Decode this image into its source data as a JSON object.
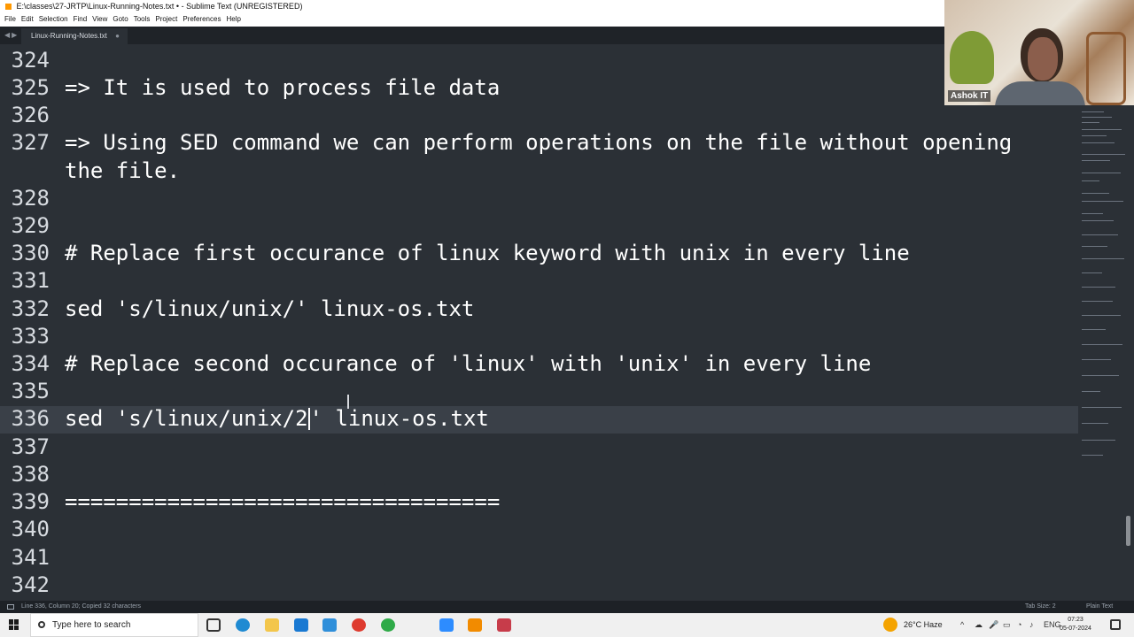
{
  "window": {
    "title": "E:\\classes\\27-JRTP\\Linux-Running-Notes.txt • - Sublime Text (UNREGISTERED)"
  },
  "menu": {
    "items": [
      "File",
      "Edit",
      "Selection",
      "Find",
      "View",
      "Goto",
      "Tools",
      "Project",
      "Preferences",
      "Help"
    ]
  },
  "tab": {
    "nav": "◀▶",
    "name": "Linux-Running-Notes.txt",
    "close": "●"
  },
  "editor": {
    "lines": [
      {
        "number": "324",
        "text": ""
      },
      {
        "number": "325",
        "text": "=> It is used to process file data"
      },
      {
        "number": "326",
        "text": ""
      },
      {
        "number": "327",
        "text": "=> Using SED command we can perform operations on the file without opening"
      },
      {
        "number": "",
        "text": "the file."
      },
      {
        "number": "328",
        "text": ""
      },
      {
        "number": "329",
        "text": ""
      },
      {
        "number": "330",
        "text": "# Replace first occurance of linux keyword with unix in every line"
      },
      {
        "number": "331",
        "text": ""
      },
      {
        "number": "332",
        "text": "sed 's/linux/unix/' linux-os.txt"
      },
      {
        "number": "333",
        "text": ""
      },
      {
        "number": "334",
        "text": "# Replace second occurance of 'linux' with 'unix' in every line"
      },
      {
        "number": "335",
        "text": ""
      },
      {
        "number": "336",
        "text_before_cursor": "sed 's/linux/unix/2",
        "text_after_cursor": "' linux-os.txt"
      },
      {
        "number": "337",
        "text": ""
      },
      {
        "number": "338",
        "text": ""
      },
      {
        "number": "339",
        "text": "=================================="
      },
      {
        "number": "340",
        "text": ""
      },
      {
        "number": "341",
        "text": ""
      },
      {
        "number": "342",
        "text": ""
      }
    ]
  },
  "status": {
    "left": "Line 336, Column 20; Copied 32 characters",
    "tab_size": "Tab Size: 2",
    "syntax": "Plain Text"
  },
  "taskbar": {
    "search_placeholder": "Type here to search",
    "weather": "26°C Haze",
    "language": "ENG",
    "time": "07:23",
    "date": "05-07-2024"
  },
  "webcam": {
    "name": "Ashok IT"
  },
  "colors": {
    "editor_bg": "#2b3036",
    "current_line_bg": "#3a4048",
    "text": "#ffffff",
    "line_numbers": "#d7dbe0"
  },
  "icons": {
    "start": "windows-start-icon",
    "search": "search-icon",
    "weather": "weather-sun-icon"
  }
}
